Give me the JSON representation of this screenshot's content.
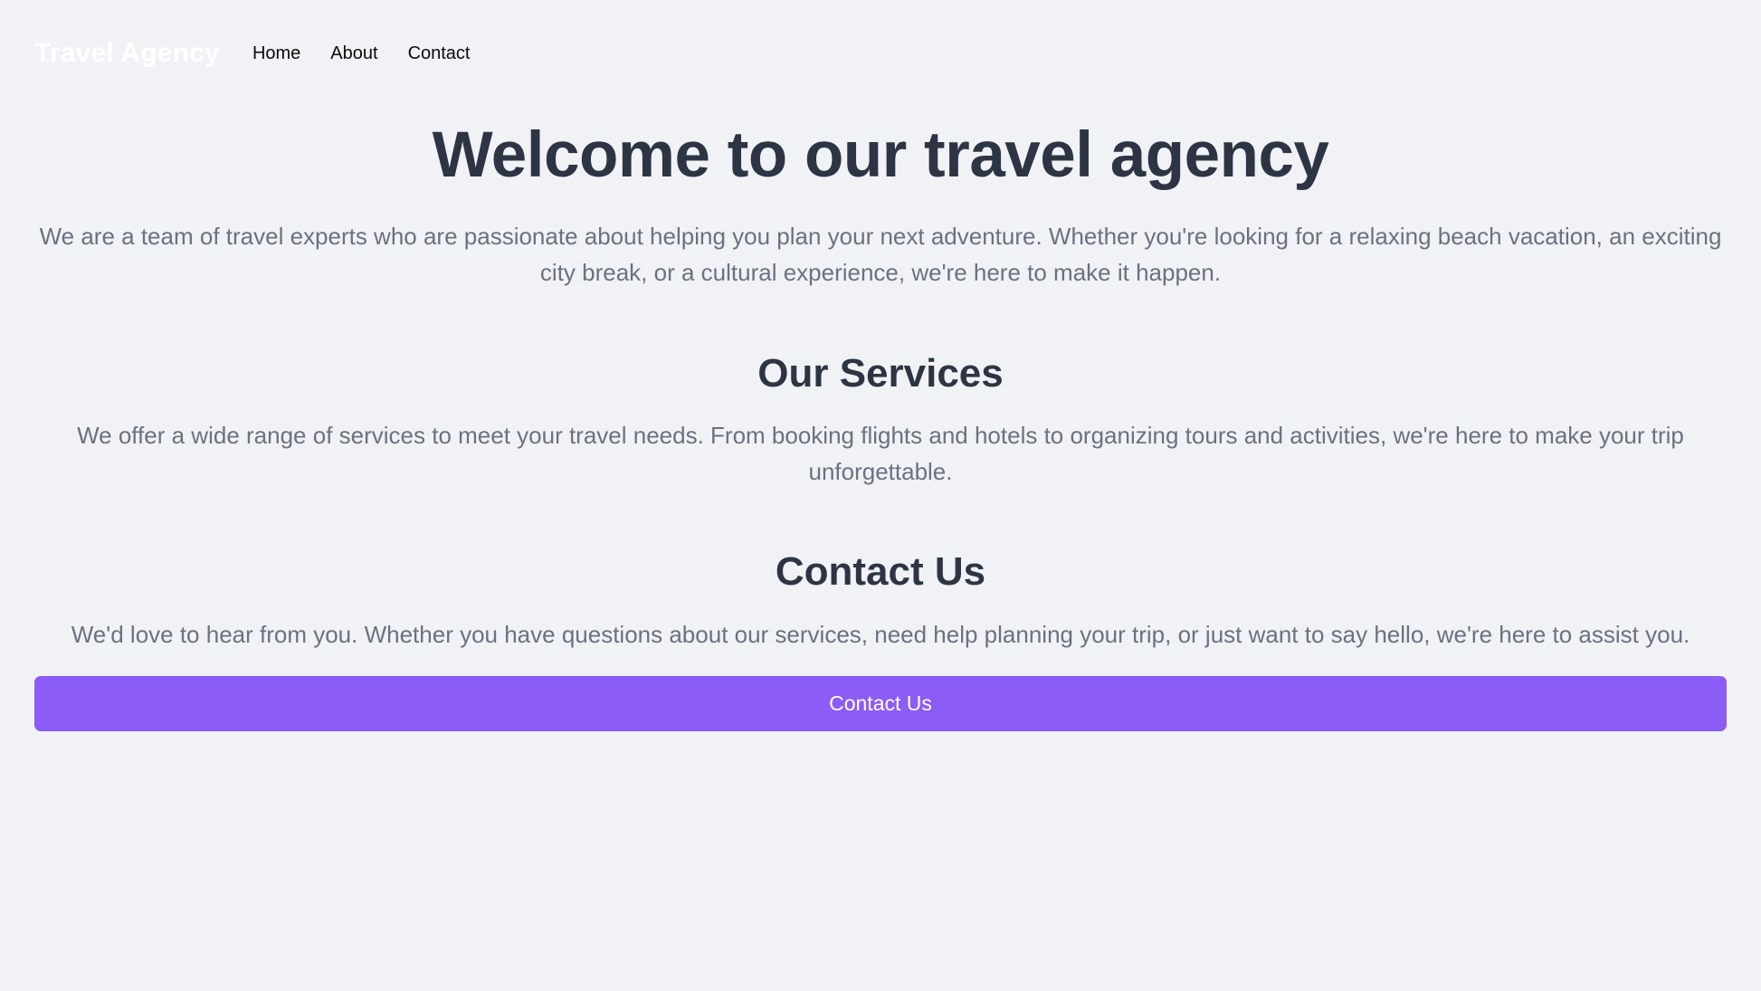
{
  "theme": {
    "background": "#f1f2f6",
    "heading_color": "#2d3544",
    "body_text_color": "#6a7180",
    "accent_color": "#8b5cf6",
    "brand_color": "#ffffff",
    "nav_link_color": "#0b0b0b"
  },
  "navbar": {
    "brand": "Travel Agency",
    "links": [
      {
        "label": "Home"
      },
      {
        "label": "About"
      },
      {
        "label": "Contact"
      }
    ]
  },
  "hero": {
    "title": "Welcome to our travel agency",
    "subtitle": "We are a team of travel experts who are passionate about helping you plan your next adventure. Whether you're looking for a relaxing beach vacation, an exciting city break, or a cultural experience, we're here to make it happen."
  },
  "services": {
    "title": "Our Services",
    "text": "We offer a wide range of services to meet your travel needs. From booking flights and hotels to organizing tours and activities, we're here to make your trip unforgettable."
  },
  "contact": {
    "title": "Contact Us",
    "text": "We'd love to hear from you. Whether you have questions about our services, need help planning your trip, or just want to say hello, we're here to assist you.",
    "button_label": "Contact Us"
  }
}
